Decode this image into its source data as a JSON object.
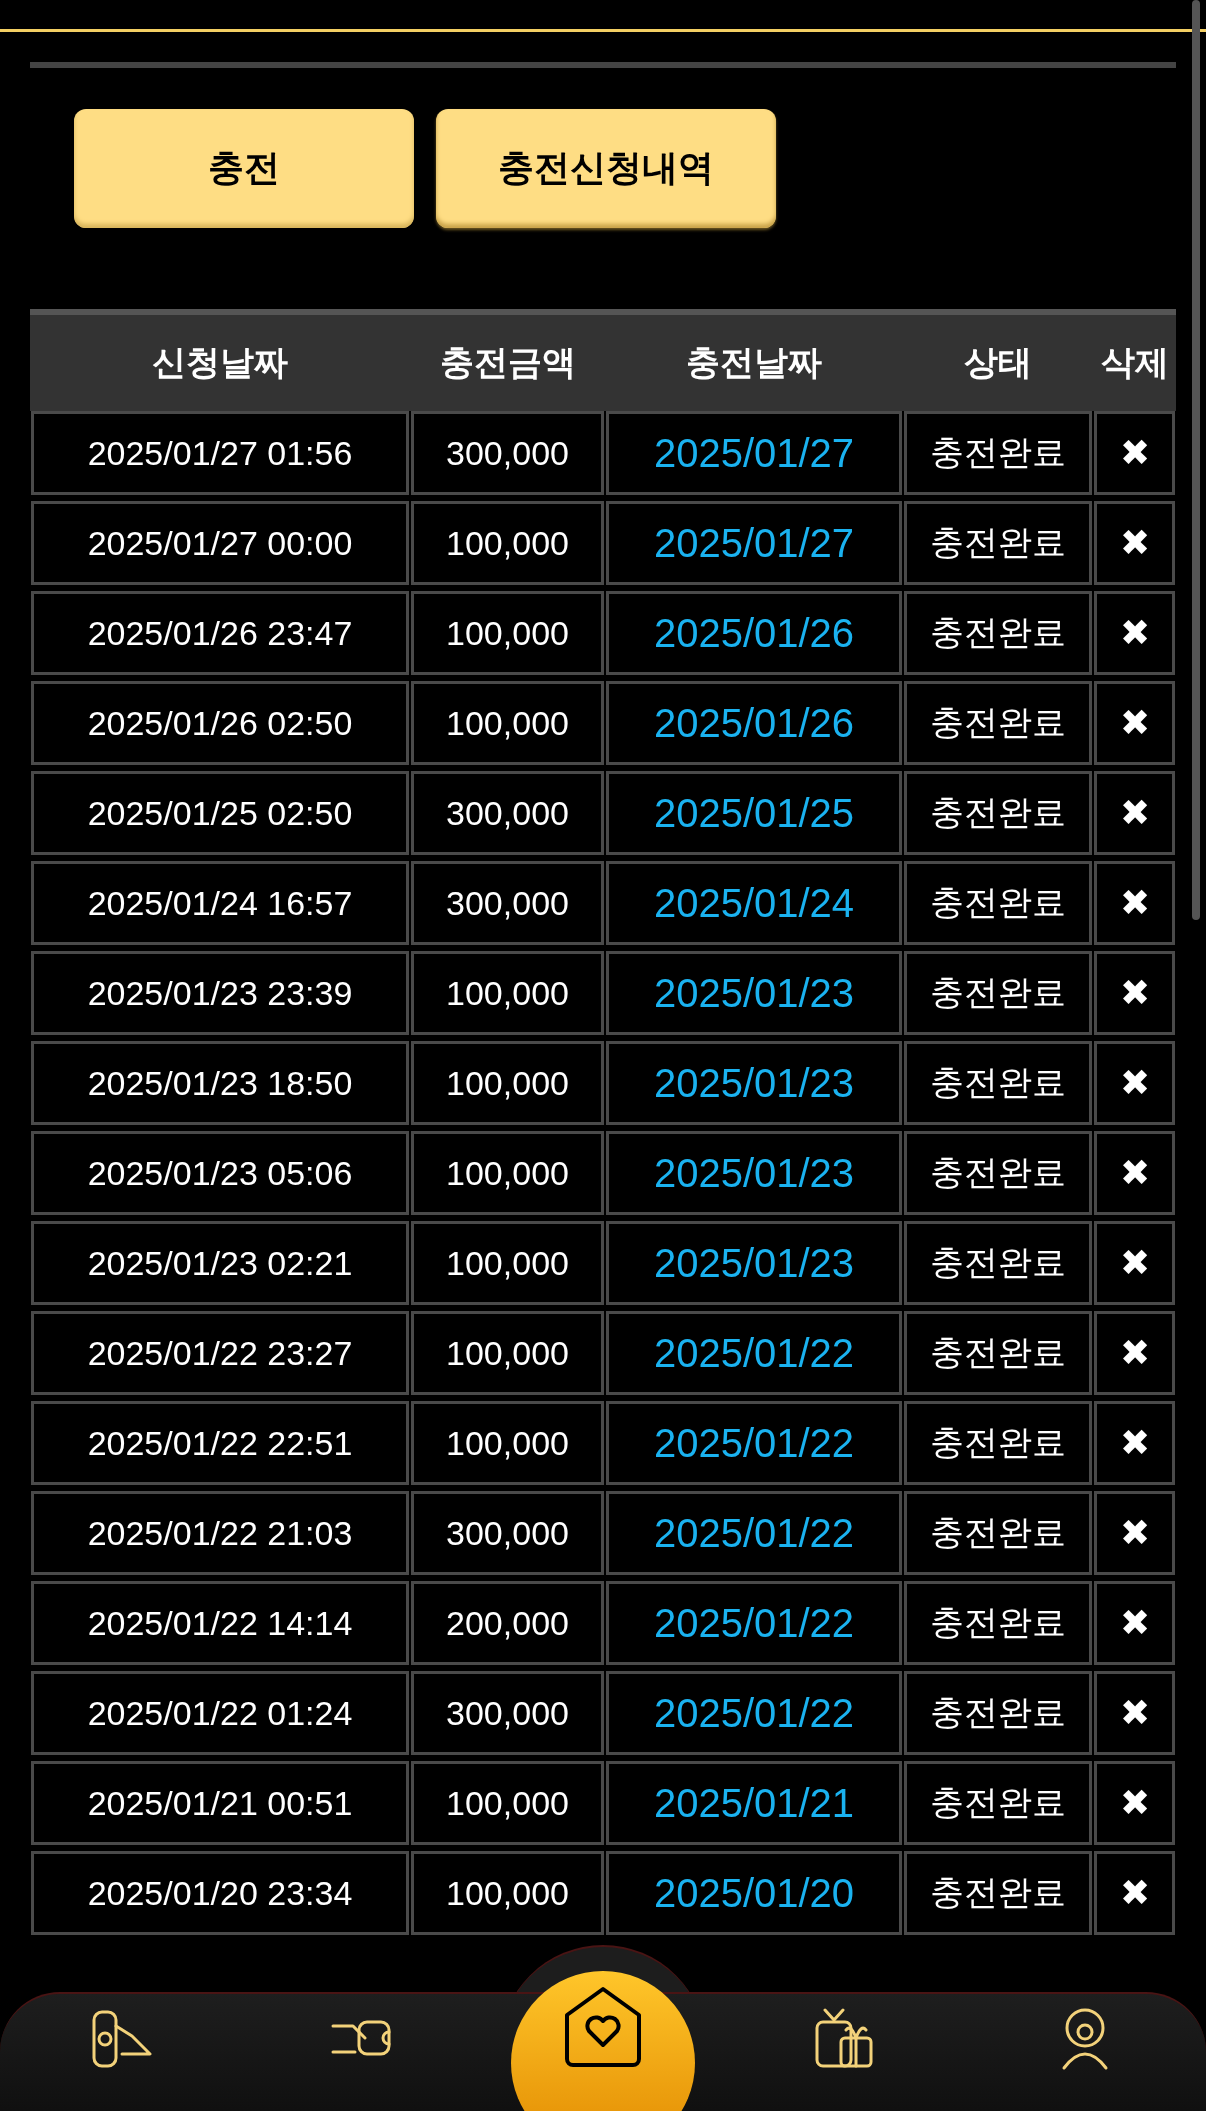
{
  "tabs": [
    {
      "label": "충전",
      "selected": false
    },
    {
      "label": "충전신청내역",
      "selected": true
    }
  ],
  "table": {
    "columns": [
      "신청날짜",
      "충전금액",
      "충전날짜",
      "상태",
      "삭제"
    ],
    "rows": [
      {
        "requested": "2025/01/27 01:56",
        "amount": "300,000",
        "charged": "2025/01/27",
        "status": "충전완료",
        "delete": "✖"
      },
      {
        "requested": "2025/01/27 00:00",
        "amount": "100,000",
        "charged": "2025/01/27",
        "status": "충전완료",
        "delete": "✖"
      },
      {
        "requested": "2025/01/26 23:47",
        "amount": "100,000",
        "charged": "2025/01/26",
        "status": "충전완료",
        "delete": "✖"
      },
      {
        "requested": "2025/01/26 02:50",
        "amount": "100,000",
        "charged": "2025/01/26",
        "status": "충전완료",
        "delete": "✖"
      },
      {
        "requested": "2025/01/25 02:50",
        "amount": "300,000",
        "charged": "2025/01/25",
        "status": "충전완료",
        "delete": "✖"
      },
      {
        "requested": "2025/01/24 16:57",
        "amount": "300,000",
        "charged": "2025/01/24",
        "status": "충전완료",
        "delete": "✖"
      },
      {
        "requested": "2025/01/23 23:39",
        "amount": "100,000",
        "charged": "2025/01/23",
        "status": "충전완료",
        "delete": "✖"
      },
      {
        "requested": "2025/01/23 18:50",
        "amount": "100,000",
        "charged": "2025/01/23",
        "status": "충전완료",
        "delete": "✖"
      },
      {
        "requested": "2025/01/23 05:06",
        "amount": "100,000",
        "charged": "2025/01/23",
        "status": "충전완료",
        "delete": "✖"
      },
      {
        "requested": "2025/01/23 02:21",
        "amount": "100,000",
        "charged": "2025/01/23",
        "status": "충전완료",
        "delete": "✖"
      },
      {
        "requested": "2025/01/22 23:27",
        "amount": "100,000",
        "charged": "2025/01/22",
        "status": "충전완료",
        "delete": "✖"
      },
      {
        "requested": "2025/01/22 22:51",
        "amount": "100,000",
        "charged": "2025/01/22",
        "status": "충전완료",
        "delete": "✖"
      },
      {
        "requested": "2025/01/22 21:03",
        "amount": "300,000",
        "charged": "2025/01/22",
        "status": "충전완료",
        "delete": "✖"
      },
      {
        "requested": "2025/01/22 14:14",
        "amount": "200,000",
        "charged": "2025/01/22",
        "status": "충전완료",
        "delete": "✖"
      },
      {
        "requested": "2025/01/22 01:24",
        "amount": "300,000",
        "charged": "2025/01/22",
        "status": "충전완료",
        "delete": "✖"
      },
      {
        "requested": "2025/01/21 00:51",
        "amount": "100,000",
        "charged": "2025/01/21",
        "status": "충전완료",
        "delete": "✖"
      },
      {
        "requested": "2025/01/20 23:34",
        "amount": "100,000",
        "charged": "2025/01/20",
        "status": "충전완료",
        "delete": "✖"
      }
    ]
  },
  "bottom_nav": [
    {
      "kind": "deposit"
    },
    {
      "kind": "withdraw"
    },
    {
      "kind": "home"
    },
    {
      "kind": "event"
    },
    {
      "kind": "support"
    }
  ]
}
